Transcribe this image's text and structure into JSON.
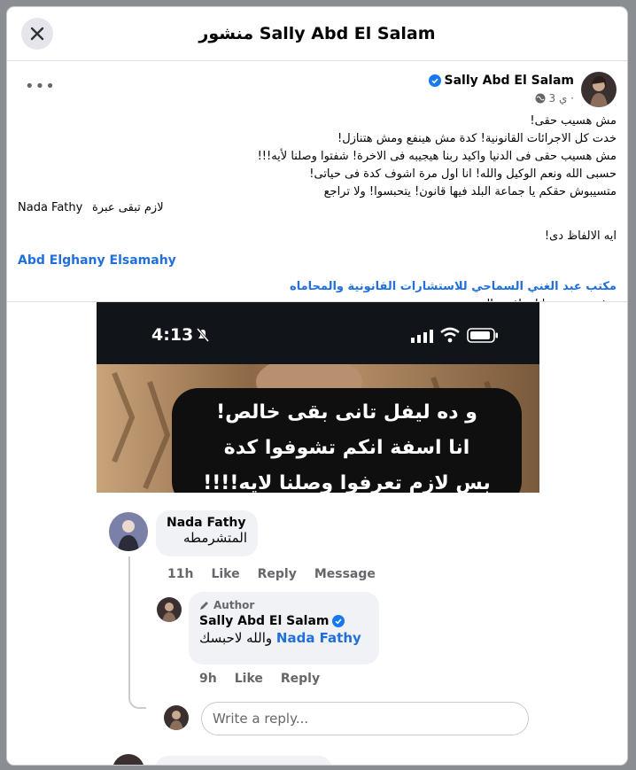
{
  "dialog": {
    "title": "منشور Sally Abd El Salam",
    "close_icon": "close-icon"
  },
  "post": {
    "author": "Sally Abd El Salam",
    "verified_icon": "verified-badge-icon",
    "meta": "3 ي ·",
    "privacy_icon": "globe-icon",
    "more_label": "•••",
    "lines": [
      "مش هسيب حقى!",
      "خدت كل الاجرائات القانونية! كدة مش هينفع ومش هتنازل!",
      "مش هسيب حقى فى الدنيا واكيد ربنا هيجيبه فى الاخرة! شفتوا وصلنا لأيه!!!",
      "حسبى الله ونعم الوكيل والله! انا اول مرة اشوف كدة فى حياتى!",
      "متسيبوش حقكم يا جماعة البلد فيها قانون! يتحبسوا! ولا تراجع"
    ],
    "nada_prefix": "Nada Fathy",
    "nada_text": "لازم تبقى عبرة",
    "line_after": "ايه الالفاظ دى!",
    "mention_elghany": "Abd Elghany Elsamahy",
    "mention_office": "مكتب عبد الغني السماحي للاستشارات القانونية والمحاماه",
    "last_line": "مش هنسيبهم يا استاذ عبدالغنى"
  },
  "screenshot": {
    "time": "4:13",
    "bubble_lines": [
      "و ده ليفل تانى بقى خالص!",
      "انا اسفة انكم تشوفوا كدة",
      "بس لازم تعرفوا وصلنا لايه!!!!"
    ],
    "comment1": {
      "name": "Nada Fathy",
      "text": "المتشرمطه",
      "time": "11h",
      "like": "Like",
      "reply": "Reply",
      "message": "Message"
    },
    "comment2": {
      "badge": "Author",
      "name": "Sally Abd El Salam",
      "text": "والله لاحبسك",
      "mention": "Nada Fathy",
      "time": "9h",
      "like": "Like",
      "reply": "Reply"
    },
    "reply_placeholder": "Write a reply..."
  }
}
